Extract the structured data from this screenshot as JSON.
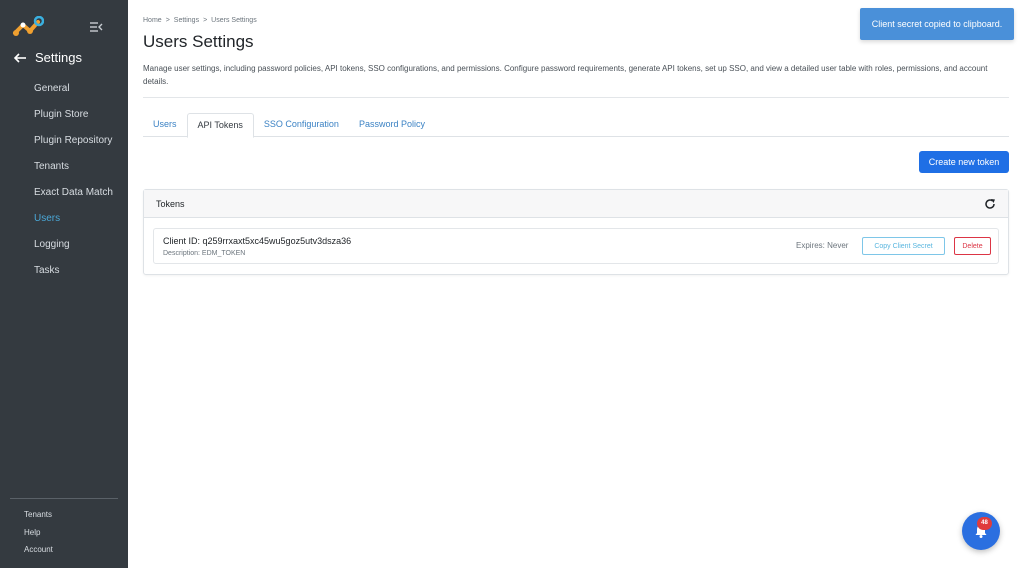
{
  "sidebar": {
    "logo_icon": "app-logo-icon",
    "collapse_icon": "sidebar-collapse-icon",
    "back_label": "Settings",
    "items": [
      {
        "label": "General",
        "active": false
      },
      {
        "label": "Plugin Store",
        "active": false
      },
      {
        "label": "Plugin Repository",
        "active": false
      },
      {
        "label": "Tenants",
        "active": false
      },
      {
        "label": "Exact Data Match",
        "active": false
      },
      {
        "label": "Users",
        "active": true
      },
      {
        "label": "Logging",
        "active": false
      },
      {
        "label": "Tasks",
        "active": false
      }
    ],
    "footer_items": [
      {
        "label": "Tenants"
      },
      {
        "label": "Help"
      },
      {
        "label": "Account"
      }
    ]
  },
  "breadcrumb": {
    "items": [
      "Home",
      "Settings",
      "Users Settings"
    ],
    "separator": ">"
  },
  "page": {
    "title": "Users Settings",
    "description": "Manage user settings, including password policies, API tokens, SSO configurations, and permissions. Configure password requirements, generate API tokens, set up SSO, and view a detailed user table with roles, permissions, and account details."
  },
  "tabs": [
    {
      "label": "Users",
      "active": false
    },
    {
      "label": "API Tokens",
      "active": true
    },
    {
      "label": "SSO Configuration",
      "active": false
    },
    {
      "label": "Password Policy",
      "active": false
    }
  ],
  "actions": {
    "create_label": "Create new token"
  },
  "tokens_card": {
    "title": "Tokens",
    "refresh_icon": "refresh-icon",
    "rows": [
      {
        "client_id": "Client ID: q259rrxaxt5xc45wu5goz5utv3dsza36",
        "description": "Description: EDM_TOKEN",
        "expires": "Expires: Never",
        "copy_label": "Copy Client Secret",
        "delete_label": "Delete"
      }
    ]
  },
  "toast": {
    "message": "Client secret copied to clipboard."
  },
  "notifications": {
    "icon": "bell-icon",
    "count": "48"
  },
  "colors": {
    "sidebar_bg": "#343a40",
    "active_nav": "#4aa8d8",
    "primary": "#1f6fe5",
    "danger": "#dc3545",
    "info": "#5ab6df",
    "toast_bg": "#4a90d9",
    "badge": "#e03c3c"
  }
}
